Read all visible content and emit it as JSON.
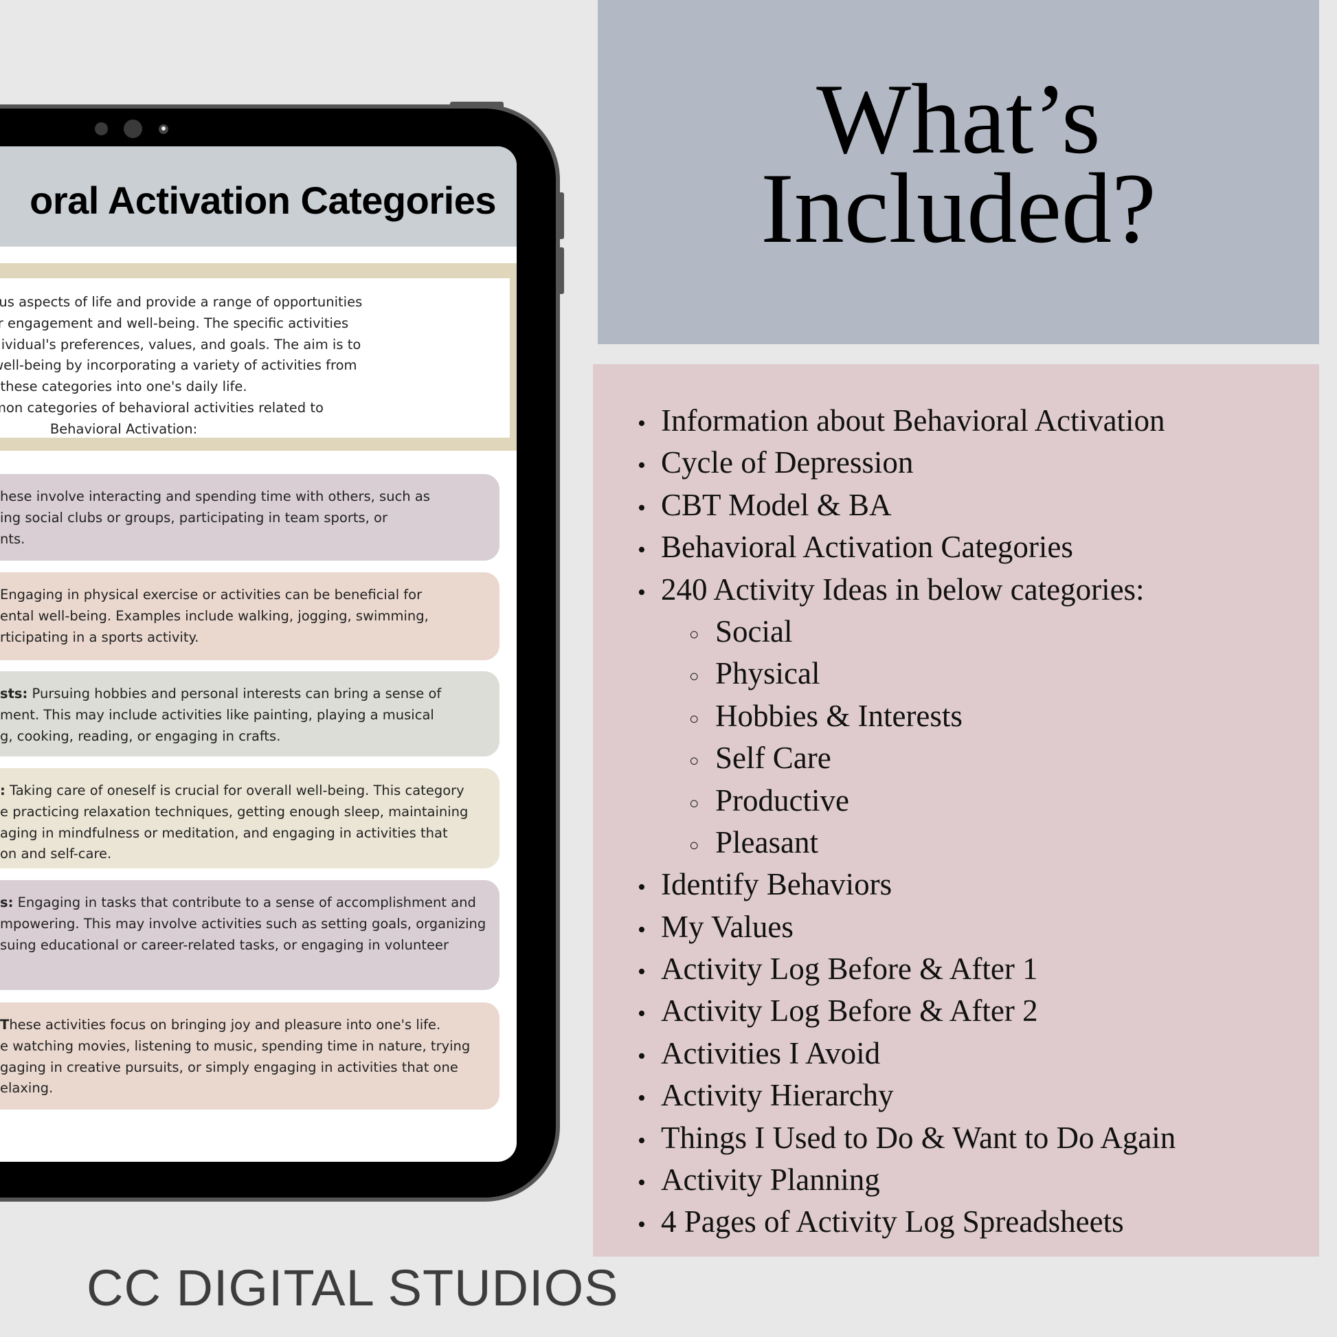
{
  "tablet": {
    "screen_title": "oral Activation Categories",
    "intro_lines": [
      "encompass various aspects of life and provide a range of opportunities",
      "o increase their engagement and well-being.  The specific activities",
      "ailored to the individual's preferences, values, and goals. The aim is to",
      "gagement and well-being by incorporating a variety of activities from",
      "these categories into one's daily life.",
      " some common categories of behavioral activities related to",
      "Behavioral Activation:"
    ],
    "cards": [
      {
        "color": "#d9ced3",
        "label": "",
        "lines": [
          "hese involve interacting and spending time with others, such as",
          "ing social clubs or groups, participating in team sports, or",
          "nts."
        ]
      },
      {
        "color": "#ead8cf",
        "label": "",
        "lines": [
          " Engaging in physical exercise or activities can be beneficial for",
          "ental well-being. Examples include walking, jogging, swimming,",
          "rticipating in a sports activity."
        ]
      },
      {
        "color": "#dcddd6",
        "label": "sts:",
        "lines": [
          " Pursuing hobbies and personal interests can bring a sense of",
          "ment. This may include activities like painting, playing a musical",
          "g, cooking, reading, or engaging in crafts."
        ]
      },
      {
        "color": "#eae5d5",
        "label": ":",
        "lines": [
          " Taking care of oneself is crucial for overall well-being. This category",
          "e practicing relaxation techniques, getting enough sleep, maintaining",
          "aging in mindfulness or meditation, and engaging in activities that",
          "on and self-care."
        ]
      },
      {
        "color": "#d9ced3",
        "label": "s:",
        "lines": [
          " Engaging in tasks that contribute to a sense of accomplishment and",
          "mpowering. This may involve activities such as setting goals, organizing",
          "suing educational or career-related tasks, or engaging in volunteer"
        ]
      },
      {
        "color": "#ead8cf",
        "label": " T",
        "lines": [
          "hese activities focus on bringing joy and pleasure into one's life.",
          "e watching movies, listening to music, spending time in nature, trying",
          "gaging in creative pursuits, or simply engaging in activities that one",
          "elaxing."
        ]
      }
    ]
  },
  "heading": {
    "line1": "What’s",
    "line2": "Included?"
  },
  "included": {
    "items": [
      {
        "text": "Information about Behavioral Activation",
        "level": 1
      },
      {
        "text": "Cycle of Depression",
        "level": 1
      },
      {
        "text": "CBT Model & BA",
        "level": 1
      },
      {
        "text": "Behavioral Activation Categories",
        "level": 1
      },
      {
        "text": "240 Activity Ideas in below categories:",
        "level": 1
      },
      {
        "text": "Social",
        "level": 2
      },
      {
        "text": "Physical",
        "level": 2
      },
      {
        "text": "Hobbies & Interests",
        "level": 2
      },
      {
        "text": "Self Care",
        "level": 2
      },
      {
        "text": "Productive",
        "level": 2
      },
      {
        "text": "Pleasant",
        "level": 2
      },
      {
        "text": "Identify Behaviors",
        "level": 1
      },
      {
        "text": "My Values",
        "level": 1
      },
      {
        "text": "Activity Log Before & After 1",
        "level": 1
      },
      {
        "text": "Activity Log Before & After 2",
        "level": 1
      },
      {
        "text": "Activities I Avoid",
        "level": 1
      },
      {
        "text": "Activity Hierarchy",
        "level": 1
      },
      {
        "text": "Things I Used to Do & Want to Do Again",
        "level": 1
      },
      {
        "text": "Activity Planning",
        "level": 1
      },
      {
        "text": "4 Pages of Activity Log Spreadsheets",
        "level": 1
      }
    ],
    "bullet_filled": "•",
    "bullet_hollow": "○"
  },
  "brand": "CC DIGITAL STUDIOS",
  "colors": {
    "background": "#e8e8e8",
    "title_panel": "#b2b9c5",
    "list_panel": "#dfcbce",
    "screen_header": "#c9cfd3",
    "intro_frame": "#e0d6bb"
  }
}
